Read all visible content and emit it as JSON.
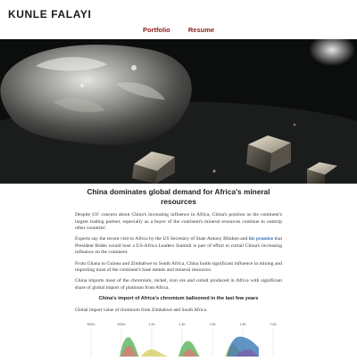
{
  "site": {
    "logo": "KUNLE FALAYI",
    "nav": [
      {
        "label": "Portfolio"
      },
      {
        "label": "Resume"
      }
    ]
  },
  "article": {
    "title": "China dominates global demand for Africa's mineral resources",
    "paragraphs": {
      "p1": "Despite US' concern about China's increasing influence in Africa, China's position as the continent's largest trading partner, especially as a buyer of the continent's mineral resources continue to outstrip other countries'.",
      "p2_before": "Experts say the recent visit to Africa by the US Secretary of State Antony Blinken and ",
      "p2_link": "his promise",
      "p2_after": " that President Biden would host a US-Africa Leaders Summit is part of effort to curtail China's increasing influence on the continent.",
      "p3": "From Ghana to Guinea and Zimbabwe to South Africa, China holds significant influence in mining and importing most of the continent's base metals and mineral resources.",
      "p4": "China imports most of the chromium, nickel, iron ore and cobalt produced in Africa with significant share of global import of platinum from Africa."
    },
    "chart_heading": "China's import of Africa's chromium ballooned in the last few years",
    "chart_subheading": "Global import value of chromium from Zimbabwe and South Africa"
  },
  "chart_data": {
    "type": "area",
    "title": "China's import of Africa's chromium ballooned in the last few years",
    "subtitle": "Global import value of chromium from Zimbabwe and South Africa",
    "tick_labels": [
      "500m",
      "600m",
      "1.0b",
      "1.4b",
      "1.5b",
      "1.8b",
      "2.0b"
    ],
    "series": [
      {
        "color": "#2c6fb0"
      },
      {
        "color": "#4caf50"
      },
      {
        "color": "#e57373"
      },
      {
        "color": "#d4c95a"
      },
      {
        "color": "#7b5ea7"
      }
    ],
    "grid": true
  }
}
